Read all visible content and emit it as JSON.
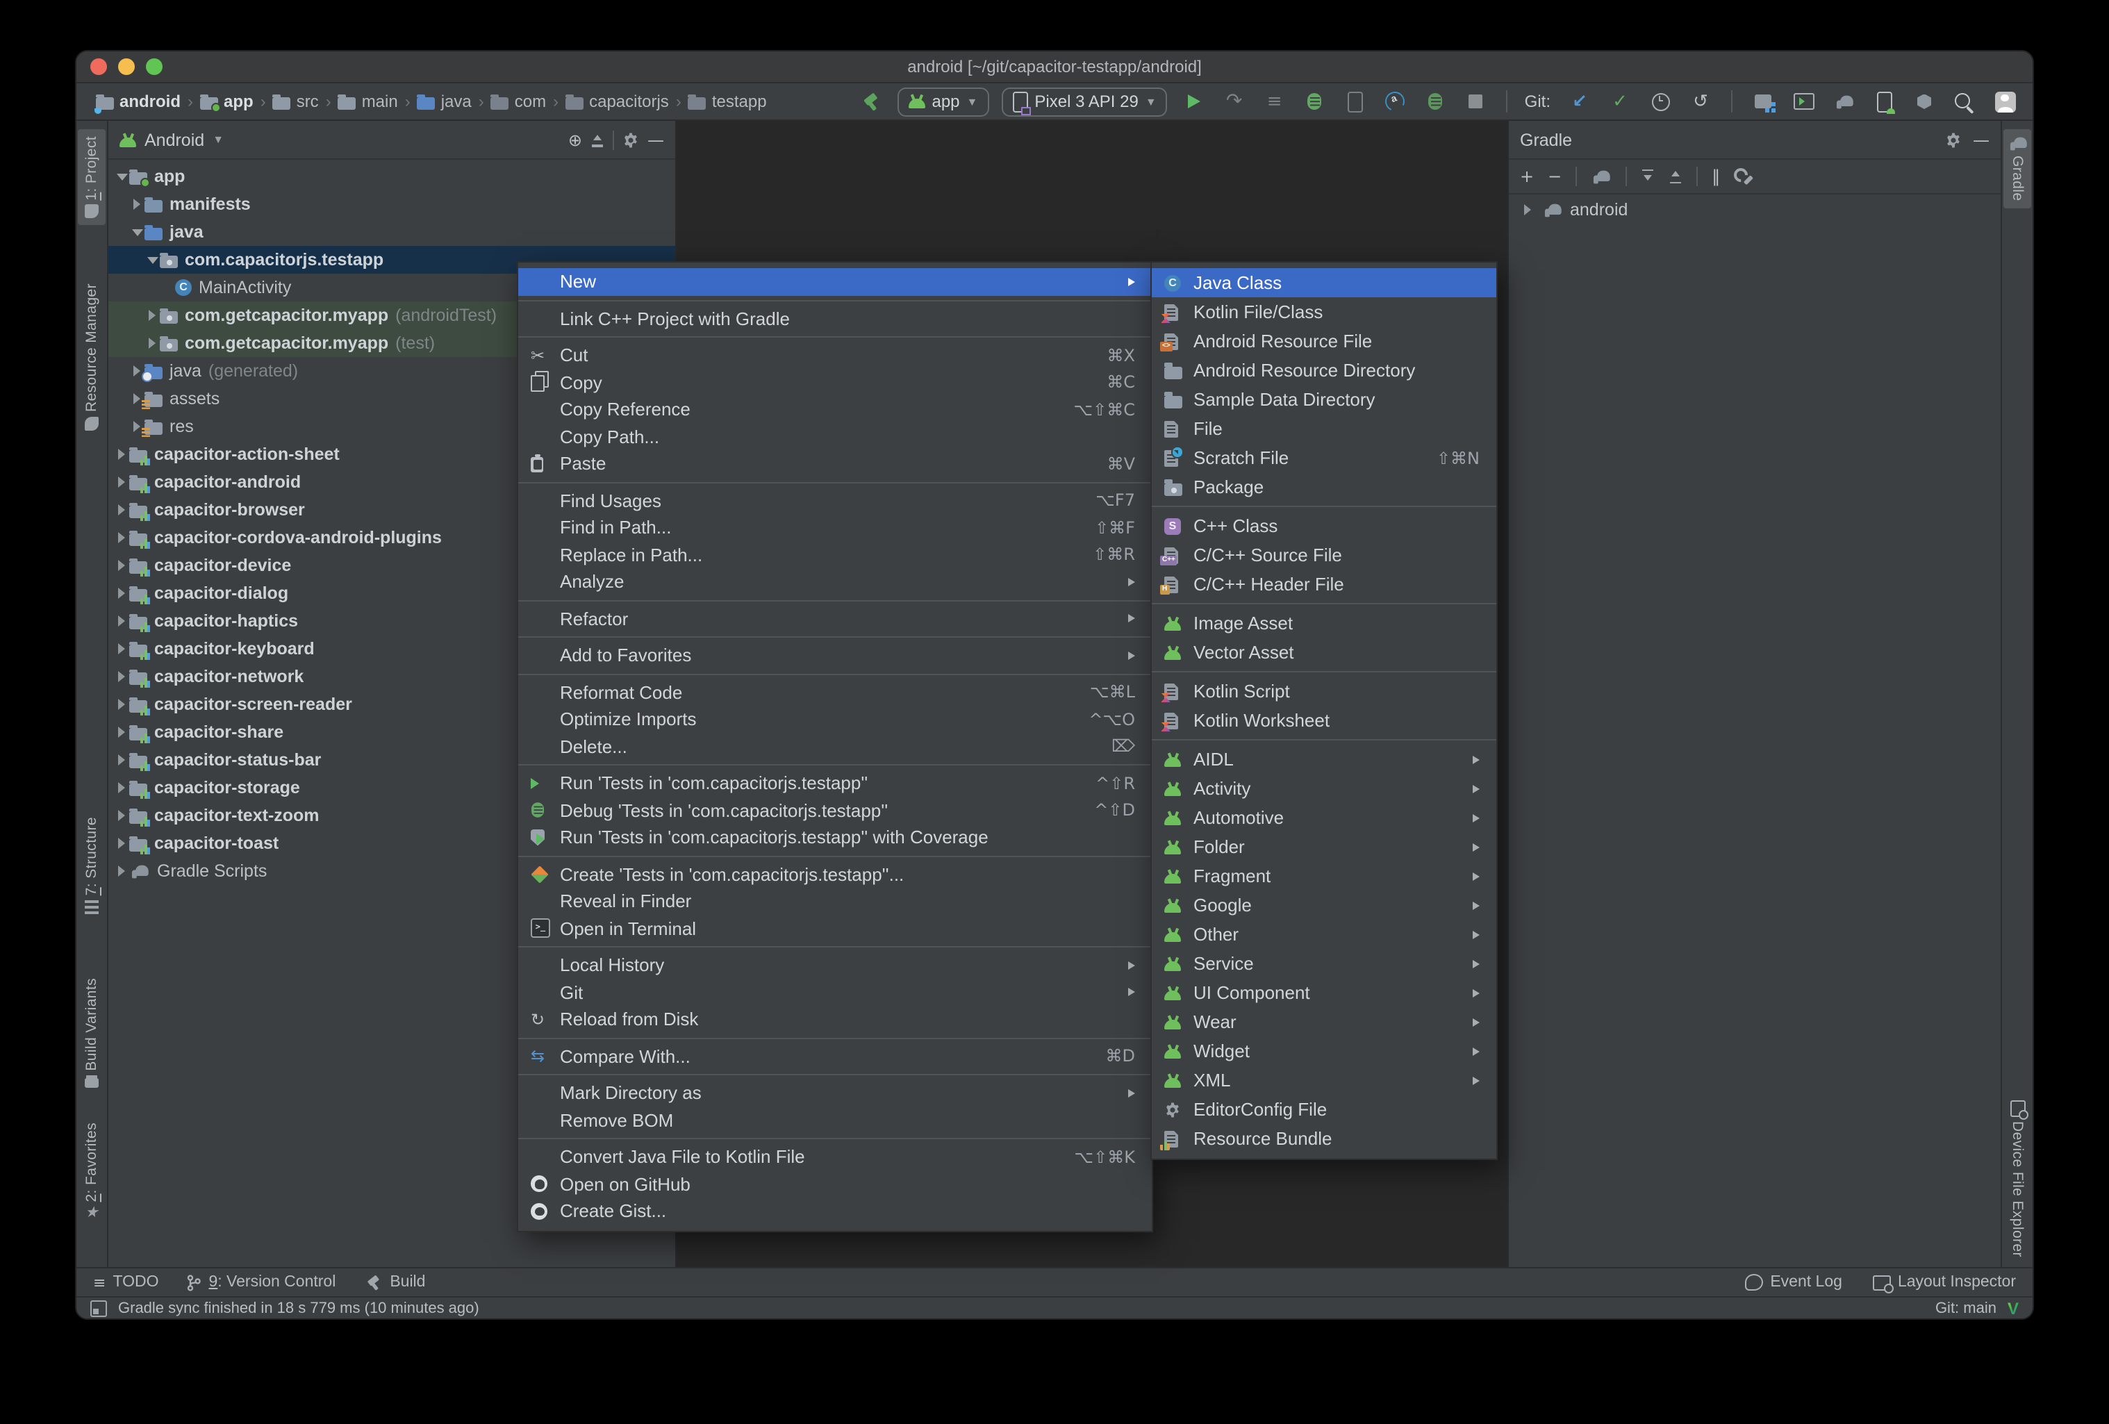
{
  "window": {
    "title": "android [~/git/capacitor-testapp/android]"
  },
  "toolbar": {
    "crumb_separator": "›",
    "breadcrumbs": [
      {
        "label": "android",
        "icon": "folder-cup",
        "bold": true
      },
      {
        "label": "app",
        "icon": "folder-app",
        "bold": true
      },
      {
        "label": "src",
        "icon": "folder",
        "bold": false
      },
      {
        "label": "main",
        "icon": "folder",
        "bold": false
      },
      {
        "label": "java",
        "icon": "folder-java",
        "bold": false
      },
      {
        "label": "com",
        "icon": "folder-dim",
        "bold": false
      },
      {
        "label": "capacitorjs",
        "icon": "folder-dim",
        "bold": false
      },
      {
        "label": "testapp",
        "icon": "folder-dim",
        "bold": false
      }
    ],
    "run_config": "app",
    "device": "Pixel 3 API 29",
    "git_label": "Git:",
    "action_icons": [
      "run-icon",
      "apply-changes-icon",
      "profiler-sessions-icon",
      "debug-icon",
      "attach-debugger-icon",
      "profile-app-icon",
      "apply-code-changes-icon",
      "stop-icon"
    ],
    "git_icons": [
      "update-project-icon",
      "commit-icon",
      "history-icon",
      "rollback-icon"
    ],
    "right_icons": [
      "modules-icon",
      "avd-manager-icon",
      "gradle-sync-icon",
      "device-manager-icon",
      "sdk-manager-icon",
      "search-everywhere-icon",
      "avatar-icon"
    ]
  },
  "left_stripe": {
    "tabs": [
      {
        "mnemonic": "1",
        "label": ": Project",
        "icon": "project",
        "active": true,
        "pos": 6
      },
      {
        "mnemonic": "",
        "label": "Resource Manager",
        "icon": "resmgr",
        "active": false,
        "pos": 112
      },
      {
        "mnemonic": "7",
        "label": ": Structure",
        "icon": "structure",
        "active": false,
        "pos": 496
      },
      {
        "mnemonic": "",
        "label": "Build Variants",
        "icon": "variants",
        "active": false,
        "pos": 612
      },
      {
        "mnemonic": "2",
        "label": ": Favorites",
        "icon": "star",
        "active": false,
        "pos": 716
      }
    ]
  },
  "right_stripe": {
    "tabs": [
      {
        "label": "Gradle",
        "icon": "gradle",
        "active": true,
        "pos": 6
      },
      {
        "label": "Device File Explorer",
        "icon": "device",
        "active": false,
        "pos": 700
      }
    ]
  },
  "project_panel": {
    "view_selector": "Android",
    "tree": [
      {
        "label": "app",
        "level": 0,
        "arrow": "expanded",
        "icon": "folder-app",
        "bold": true
      },
      {
        "label": "manifests",
        "level": 1,
        "arrow": "collapsed",
        "icon": "folder-manifests",
        "bold": true
      },
      {
        "label": "java",
        "level": 1,
        "arrow": "expanded",
        "icon": "folder-java",
        "bold": true
      },
      {
        "label": "com.capacitorjs.testapp",
        "level": 2,
        "arrow": "expanded",
        "icon": "folder-package",
        "bold": true,
        "state": "selected"
      },
      {
        "label": "MainActivity",
        "level": 3,
        "arrow": "none",
        "icon": "class",
        "bold": false
      },
      {
        "label": "com.getcapacitor.myapp",
        "suffix": "(androidTest)",
        "level": 2,
        "arrow": "collapsed",
        "icon": "folder-package",
        "bold": true,
        "state": "testbg"
      },
      {
        "label": "com.getcapacitor.myapp",
        "suffix": "(test)",
        "level": 2,
        "arrow": "collapsed",
        "icon": "folder-package",
        "bold": true,
        "state": "testbg"
      },
      {
        "label": "java",
        "suffix": "(generated)",
        "level": 1,
        "arrow": "collapsed",
        "icon": "folder-generated",
        "bold": false
      },
      {
        "label": "assets",
        "level": 1,
        "arrow": "collapsed",
        "icon": "folder-assets",
        "bold": false
      },
      {
        "label": "res",
        "level": 1,
        "arrow": "collapsed",
        "icon": "folder-res",
        "bold": false
      },
      {
        "label": "capacitor-action-sheet",
        "level": 0,
        "arrow": "collapsed",
        "icon": "module",
        "bold": true
      },
      {
        "label": "capacitor-android",
        "level": 0,
        "arrow": "collapsed",
        "icon": "module",
        "bold": true
      },
      {
        "label": "capacitor-browser",
        "level": 0,
        "arrow": "collapsed",
        "icon": "module",
        "bold": true
      },
      {
        "label": "capacitor-cordova-android-plugins",
        "level": 0,
        "arrow": "collapsed",
        "icon": "module",
        "bold": true
      },
      {
        "label": "capacitor-device",
        "level": 0,
        "arrow": "collapsed",
        "icon": "module",
        "bold": true
      },
      {
        "label": "capacitor-dialog",
        "level": 0,
        "arrow": "collapsed",
        "icon": "module",
        "bold": true
      },
      {
        "label": "capacitor-haptics",
        "level": 0,
        "arrow": "collapsed",
        "icon": "module",
        "bold": true
      },
      {
        "label": "capacitor-keyboard",
        "level": 0,
        "arrow": "collapsed",
        "icon": "module",
        "bold": true
      },
      {
        "label": "capacitor-network",
        "level": 0,
        "arrow": "collapsed",
        "icon": "module",
        "bold": true
      },
      {
        "label": "capacitor-screen-reader",
        "level": 0,
        "arrow": "collapsed",
        "icon": "module",
        "bold": true
      },
      {
        "label": "capacitor-share",
        "level": 0,
        "arrow": "collapsed",
        "icon": "module",
        "bold": true
      },
      {
        "label": "capacitor-status-bar",
        "level": 0,
        "arrow": "collapsed",
        "icon": "module",
        "bold": true
      },
      {
        "label": "capacitor-storage",
        "level": 0,
        "arrow": "collapsed",
        "icon": "module",
        "bold": true
      },
      {
        "label": "capacitor-text-zoom",
        "level": 0,
        "arrow": "collapsed",
        "icon": "module",
        "bold": true
      },
      {
        "label": "capacitor-toast",
        "level": 0,
        "arrow": "collapsed",
        "icon": "module",
        "bold": true
      },
      {
        "label": "Gradle Scripts",
        "level": 0,
        "arrow": "collapsed",
        "icon": "gradle",
        "bold": false
      }
    ]
  },
  "gradle_panel": {
    "title": "Gradle",
    "root": "android",
    "tool_icons": [
      "add-icon",
      "remove-icon",
      "gradle-icon",
      "expand-all-icon",
      "collapse-all-icon",
      "offline-mode-icon",
      "gradle-settings-wrench-icon"
    ]
  },
  "context_menu": {
    "items": [
      {
        "label": "New",
        "selected": true,
        "arrow": true
      },
      {
        "type": "sep"
      },
      {
        "label": "Link C++ Project with Gradle"
      },
      {
        "type": "sep"
      },
      {
        "label": "Cut",
        "icon": "cut",
        "shortcut": "⌘X"
      },
      {
        "label": "Copy",
        "icon": "copy",
        "shortcut": "⌘C"
      },
      {
        "label": "Copy Reference",
        "shortcut": "⌥⇧⌘C"
      },
      {
        "label": "Copy Path..."
      },
      {
        "label": "Paste",
        "icon": "paste",
        "shortcut": "⌘V"
      },
      {
        "type": "sep"
      },
      {
        "label": "Find Usages",
        "shortcut": "⌥F7"
      },
      {
        "label": "Find in Path...",
        "shortcut": "⇧⌘F"
      },
      {
        "label": "Replace in Path...",
        "shortcut": "⇧⌘R"
      },
      {
        "label": "Analyze",
        "arrow": true
      },
      {
        "type": "sep"
      },
      {
        "label": "Refactor",
        "arrow": true
      },
      {
        "type": "sep"
      },
      {
        "label": "Add to Favorites",
        "arrow": true
      },
      {
        "type": "sep"
      },
      {
        "label": "Reformat Code",
        "shortcut": "⌥⌘L"
      },
      {
        "label": "Optimize Imports",
        "shortcut": "^⌥O"
      },
      {
        "label": "Delete...",
        "shortcut": "⌦"
      },
      {
        "type": "sep"
      },
      {
        "label": "Run 'Tests in 'com.capacitorjs.testapp''",
        "icon": "run",
        "shortcut": "^⇧R"
      },
      {
        "label": "Debug 'Tests in 'com.capacitorjs.testapp''",
        "icon": "debug",
        "shortcut": "^⇧D"
      },
      {
        "label": "Run 'Tests in 'com.capacitorjs.testapp'' with Coverage",
        "icon": "coverage"
      },
      {
        "type": "sep"
      },
      {
        "label": "Create 'Tests in 'com.capacitorjs.testapp''...",
        "icon": "newtest"
      },
      {
        "label": "Reveal in Finder"
      },
      {
        "label": "Open in Terminal",
        "icon": "terminal"
      },
      {
        "type": "sep"
      },
      {
        "label": "Local History",
        "arrow": true
      },
      {
        "label": "Git",
        "arrow": true
      },
      {
        "label": "Reload from Disk",
        "icon": "reload"
      },
      {
        "type": "sep"
      },
      {
        "label": "Compare With...",
        "icon": "compare",
        "shortcut": "⌘D"
      },
      {
        "type": "sep"
      },
      {
        "label": "Mark Directory as",
        "arrow": true
      },
      {
        "label": "Remove BOM"
      },
      {
        "type": "sep"
      },
      {
        "label": "Convert Java File to Kotlin File",
        "shortcut": "⌥⇧⌘K"
      },
      {
        "label": "Open on GitHub",
        "icon": "github"
      },
      {
        "label": "Create Gist...",
        "icon": "github"
      }
    ]
  },
  "submenu": {
    "items": [
      {
        "label": "Java Class",
        "icon": "java-class",
        "selected": true
      },
      {
        "label": "Kotlin File/Class",
        "icon": "kotlin-file"
      },
      {
        "label": "Android Resource File",
        "icon": "android-res-file"
      },
      {
        "label": "Android Resource Directory",
        "icon": "folder-plain"
      },
      {
        "label": "Sample Data Directory",
        "icon": "folder-plain"
      },
      {
        "label": "File",
        "icon": "file"
      },
      {
        "label": "Scratch File",
        "icon": "scratch",
        "shortcut": "⇧⌘N"
      },
      {
        "label": "Package",
        "icon": "package"
      },
      {
        "type": "sep"
      },
      {
        "label": "C++ Class",
        "icon": "cpp-class"
      },
      {
        "label": "C/C++ Source File",
        "icon": "cpp-source"
      },
      {
        "label": "C/C++ Header File",
        "icon": "cpp-header"
      },
      {
        "type": "sep"
      },
      {
        "label": "Image Asset",
        "icon": "android"
      },
      {
        "label": "Vector Asset",
        "icon": "android"
      },
      {
        "type": "sep"
      },
      {
        "label": "Kotlin Script",
        "icon": "kotlin-script"
      },
      {
        "label": "Kotlin Worksheet",
        "icon": "kotlin-script"
      },
      {
        "type": "sep"
      },
      {
        "label": "AIDL",
        "icon": "android",
        "arrow": true
      },
      {
        "label": "Activity",
        "icon": "android",
        "arrow": true
      },
      {
        "label": "Automotive",
        "icon": "android",
        "arrow": true
      },
      {
        "label": "Folder",
        "icon": "android",
        "arrow": true
      },
      {
        "label": "Fragment",
        "icon": "android",
        "arrow": true
      },
      {
        "label": "Google",
        "icon": "android",
        "arrow": true
      },
      {
        "label": "Other",
        "icon": "android",
        "arrow": true
      },
      {
        "label": "Service",
        "icon": "android",
        "arrow": true
      },
      {
        "label": "UI Component",
        "icon": "android",
        "arrow": true
      },
      {
        "label": "Wear",
        "icon": "android",
        "arrow": true
      },
      {
        "label": "Widget",
        "icon": "android",
        "arrow": true
      },
      {
        "label": "XML",
        "icon": "android",
        "arrow": true
      },
      {
        "label": "EditorConfig File",
        "icon": "gear"
      },
      {
        "label": "Resource Bundle",
        "icon": "resource-bundle"
      }
    ]
  },
  "bottom_bar": {
    "left": [
      {
        "label": "TODO",
        "icon": "todo",
        "mnemonic": ""
      },
      {
        "label": ": Version Control",
        "icon": "branch",
        "mnemonic": "9"
      },
      {
        "label": "Build",
        "icon": "hammer-gray",
        "mnemonic": ""
      }
    ],
    "right": [
      {
        "label": "Event Log",
        "icon": "bubble",
        "mnemonic": ""
      },
      {
        "label": "Layout Inspector",
        "icon": "layout",
        "mnemonic": ""
      }
    ]
  },
  "status_bar": {
    "message": "Gradle sync finished in 18 s 779 ms (10 minutes ago)",
    "git": "Git: main"
  }
}
